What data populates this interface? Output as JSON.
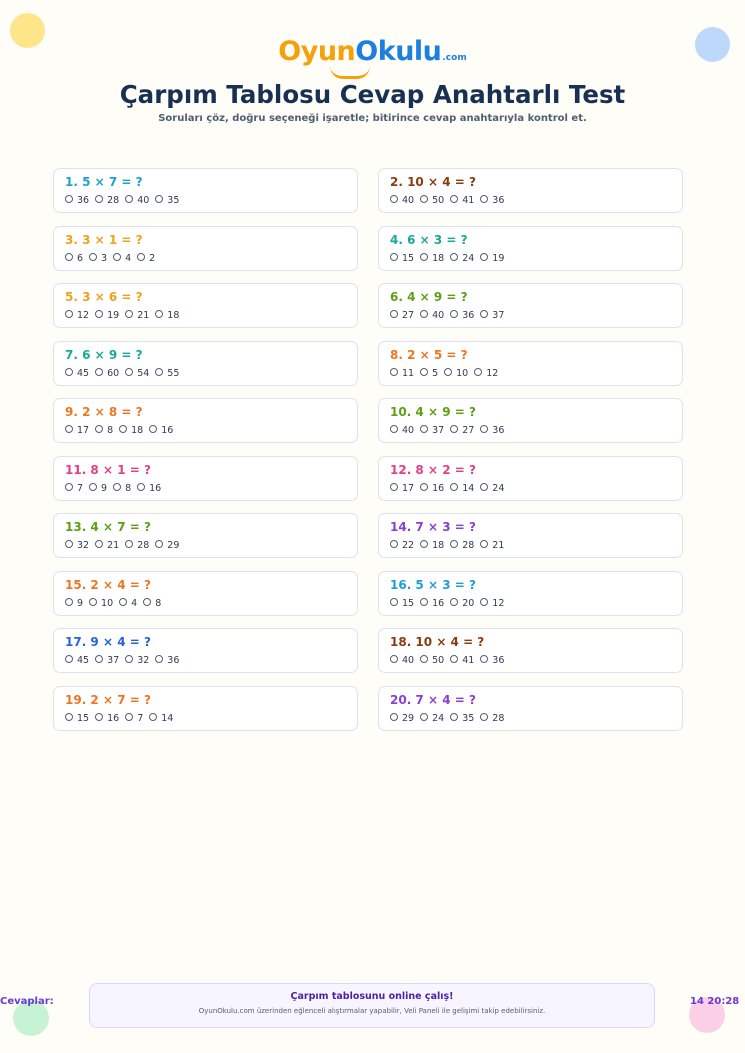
{
  "header": {
    "logo_oyun": "Oyun",
    "logo_okulu": "Okulu",
    "logo_com": ".com",
    "title": "Çarpım Tablosu Cevap Anahtarlı Test",
    "subtitle": "Soruları çöz, doğru seçeneği işaretle; bitirince cevap anahtarıyla kontrol et."
  },
  "questions": [
    {
      "label": "1. 5 × 7 = ?",
      "color": "#1f9ed6",
      "options": [
        "36",
        "28",
        "40",
        "35"
      ]
    },
    {
      "label": "2. 10 × 4 = ?",
      "color": "#8a3b12",
      "options": [
        "40",
        "50",
        "41",
        "36"
      ]
    },
    {
      "label": "3. 3 × 1 = ?",
      "color": "#eea21a",
      "options": [
        "6",
        "3",
        "4",
        "2"
      ]
    },
    {
      "label": "4. 6 × 3 = ?",
      "color": "#16a99a",
      "options": [
        "15",
        "18",
        "24",
        "19"
      ]
    },
    {
      "label": "5. 3 × 6 = ?",
      "color": "#eea21a",
      "options": [
        "12",
        "19",
        "21",
        "18"
      ]
    },
    {
      "label": "6. 4 × 9 = ?",
      "color": "#5f9e12",
      "options": [
        "27",
        "40",
        "36",
        "37"
      ]
    },
    {
      "label": "7. 6 × 9 = ?",
      "color": "#16a99a",
      "options": [
        "45",
        "60",
        "54",
        "55"
      ]
    },
    {
      "label": "8. 2 × 5 = ?",
      "color": "#ee7622",
      "options": [
        "11",
        "5",
        "10",
        "12"
      ]
    },
    {
      "label": "9. 2 × 8 = ?",
      "color": "#ee7622",
      "options": [
        "17",
        "8",
        "18",
        "16"
      ]
    },
    {
      "label": "10. 4 × 9 = ?",
      "color": "#5f9e12",
      "options": [
        "40",
        "37",
        "27",
        "36"
      ]
    },
    {
      "label": "11. 8 × 1 = ?",
      "color": "#e0408a",
      "options": [
        "7",
        "9",
        "8",
        "16"
      ]
    },
    {
      "label": "12. 8 × 2 = ?",
      "color": "#e0408a",
      "options": [
        "17",
        "16",
        "14",
        "24"
      ]
    },
    {
      "label": "13. 4 × 7 = ?",
      "color": "#5f9e12",
      "options": [
        "32",
        "21",
        "28",
        "29"
      ]
    },
    {
      "label": "14. 7 × 3 = ?",
      "color": "#8a3fd1",
      "options": [
        "22",
        "18",
        "28",
        "21"
      ]
    },
    {
      "label": "15. 2 × 4 = ?",
      "color": "#ee7622",
      "options": [
        "9",
        "10",
        "4",
        "8"
      ]
    },
    {
      "label": "16. 5 × 3 = ?",
      "color": "#1f9ed6",
      "options": [
        "15",
        "16",
        "20",
        "12"
      ]
    },
    {
      "label": "17. 9 × 4 = ?",
      "color": "#2563d6",
      "options": [
        "45",
        "37",
        "32",
        "36"
      ]
    },
    {
      "label": "18. 10 × 4 = ?",
      "color": "#8a3b12",
      "options": [
        "40",
        "50",
        "41",
        "36"
      ]
    },
    {
      "label": "19. 2 × 7 = ?",
      "color": "#ee7622",
      "options": [
        "15",
        "16",
        "7",
        "14"
      ]
    },
    {
      "label": "20. 7 × 4 = ?",
      "color": "#8a3fd1",
      "options": [
        "29",
        "24",
        "35",
        "28"
      ]
    }
  ],
  "footer": {
    "answers_label": "Cevaplar:",
    "answer_key": "14  20:28",
    "promo_title": "Çarpım tablosunu online çalış!",
    "promo_text": "OyunOkulu.com üzerinden eğlenceli alıştırmalar yapabilir, Veli Paneli ile gelişimi takip edebilirsiniz."
  }
}
